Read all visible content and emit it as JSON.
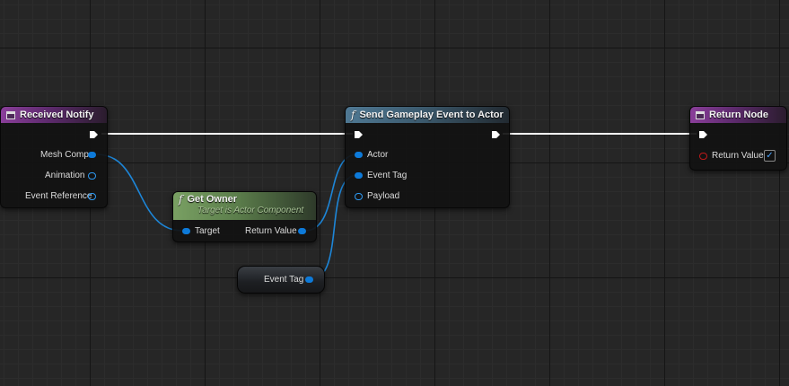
{
  "nodes": {
    "received_notify": {
      "title": "Received Notify",
      "pins": {
        "mesh_comp": "Mesh Comp",
        "animation": "Animation",
        "event_reference": "Event Reference"
      }
    },
    "get_owner": {
      "title": "Get Owner",
      "subtitle": "Target is Actor Component",
      "pins": {
        "target": "Target",
        "return_value": "Return Value"
      }
    },
    "send_gameplay_event": {
      "title": "Send Gameplay Event to Actor",
      "pins": {
        "actor": "Actor",
        "event_tag": "Event Tag",
        "payload": "Payload"
      }
    },
    "return_node": {
      "title": "Return Node",
      "pins": {
        "return_value": "Return Value"
      },
      "return_value_checked": true
    },
    "event_tag_var": {
      "label": "Event Tag"
    }
  },
  "colors": {
    "object_pin": "#0d7ad9",
    "struct_pin": "#2e9af3",
    "bool_pin": "#c01a1a",
    "exec_wire": "#ffffff",
    "header_event": "#8a3e9a",
    "header_function": "#4f7893",
    "header_pure": "#79a063"
  },
  "icons": {
    "event": "event-node-icon",
    "function": "function-f-icon",
    "exec": "exec-arrow-icon",
    "check": "checkmark-icon"
  }
}
